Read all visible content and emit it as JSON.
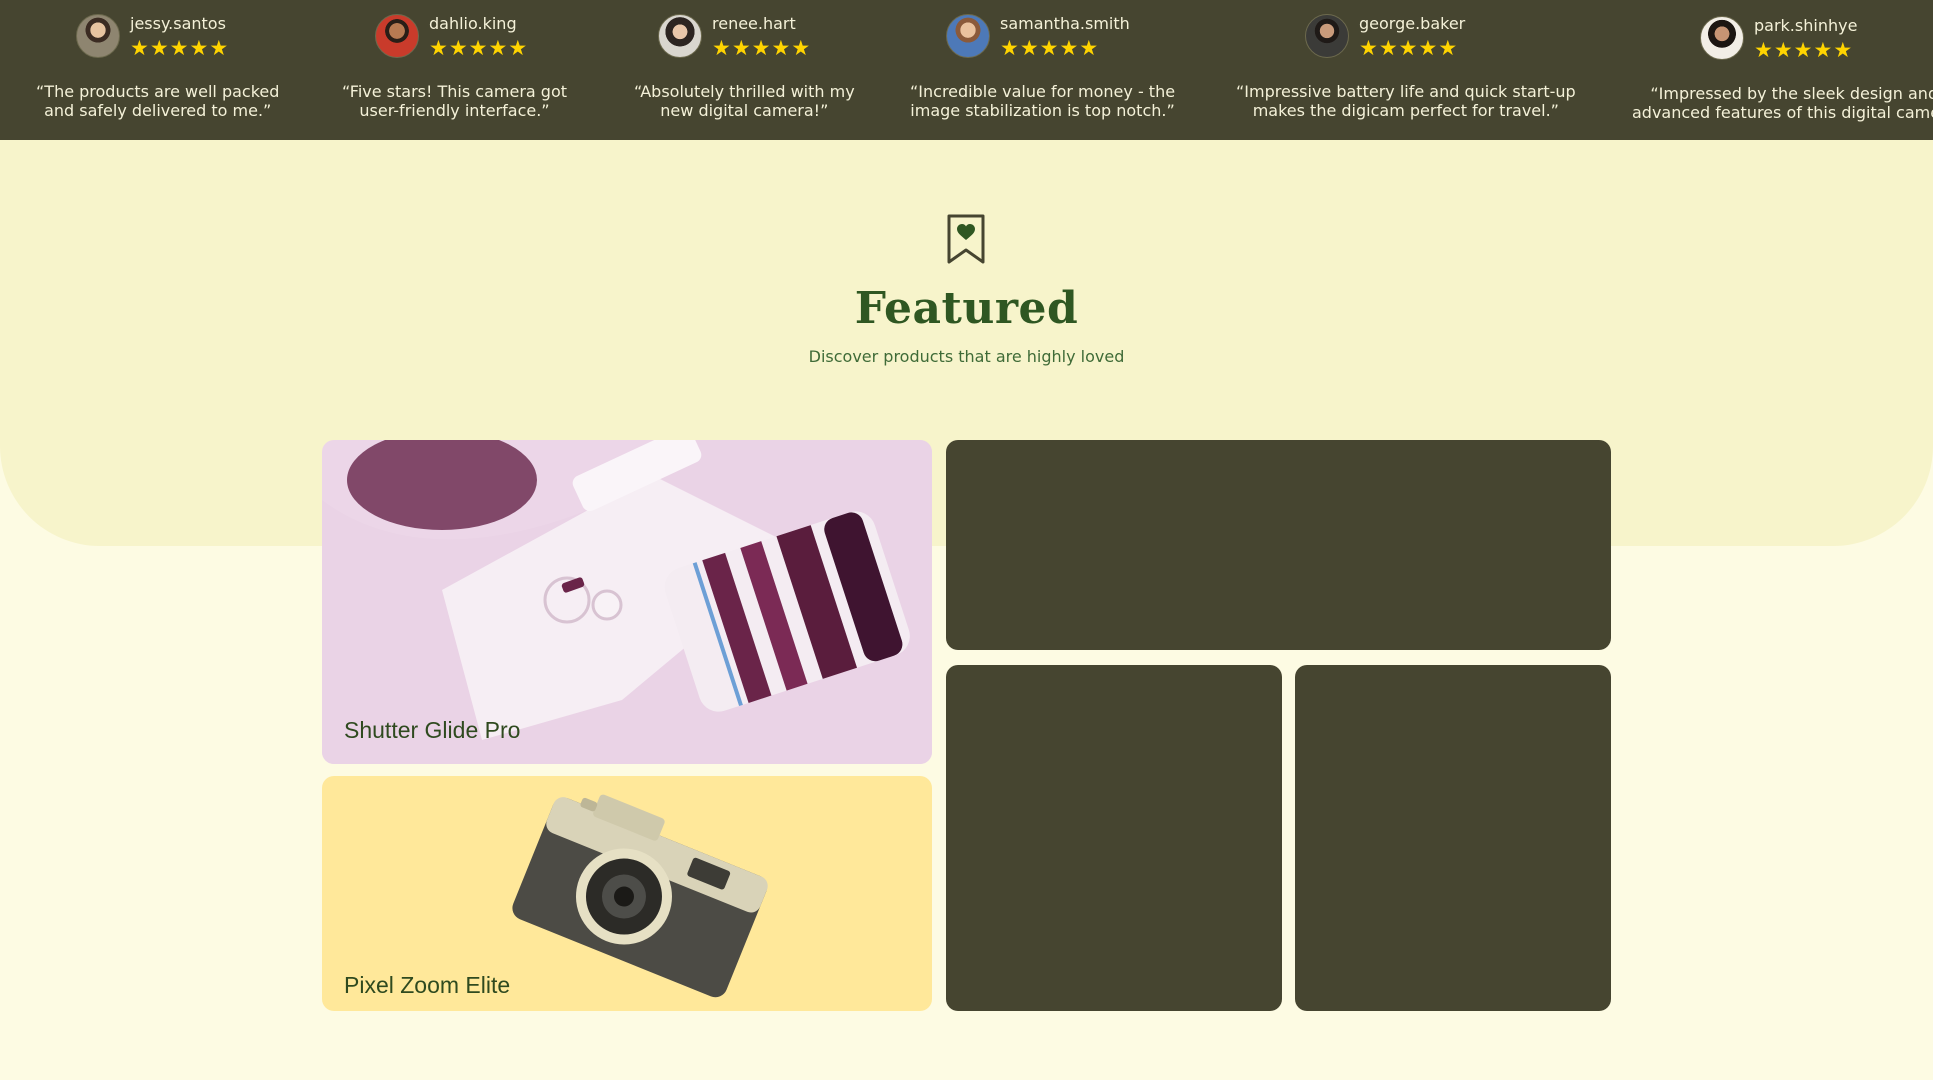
{
  "reviews": [
    {
      "username": "jessy.santos",
      "rating": 5,
      "quote_line1": "“The products are well packed",
      "quote_line2": "and safely delivered to me.”"
    },
    {
      "username": "dahlio.king",
      "rating": 5,
      "quote_line1": "“Five stars! This camera got",
      "quote_line2": "user-friendly interface.”"
    },
    {
      "username": "renee.hart",
      "rating": 5,
      "quote_line1": "“Absolutely thrilled with my",
      "quote_line2": "new digital camera!”"
    },
    {
      "username": "samantha.smith",
      "rating": 5,
      "quote_line1": "“Incredible value for money - the",
      "quote_line2": "image stabilization is top notch.”"
    },
    {
      "username": "george.baker",
      "rating": 5,
      "quote_line1": "“Impressive battery life and quick start-up",
      "quote_line2": "makes the digicam perfect for travel.”"
    },
    {
      "username": "park.shinhye",
      "rating": 5,
      "quote_line1": "“Impressed by the sleek design and",
      "quote_line2": "advanced features of this digital camera"
    }
  ],
  "featured": {
    "icon": "bookmark-heart-icon",
    "title": "Featured",
    "subtitle": "Discover products that are highly loved"
  },
  "products": [
    {
      "name": "Shutter Glide Pro",
      "background": "#ecd6e8"
    },
    {
      "name": "Pixel Zoom Elite",
      "background": "#ffe89a"
    }
  ],
  "colors": {
    "strip_background": "#464530",
    "page_background": "#fdfbe3",
    "hero_background": "#f7f4cb",
    "star": "#ffd400",
    "heading": "#2f5722"
  }
}
